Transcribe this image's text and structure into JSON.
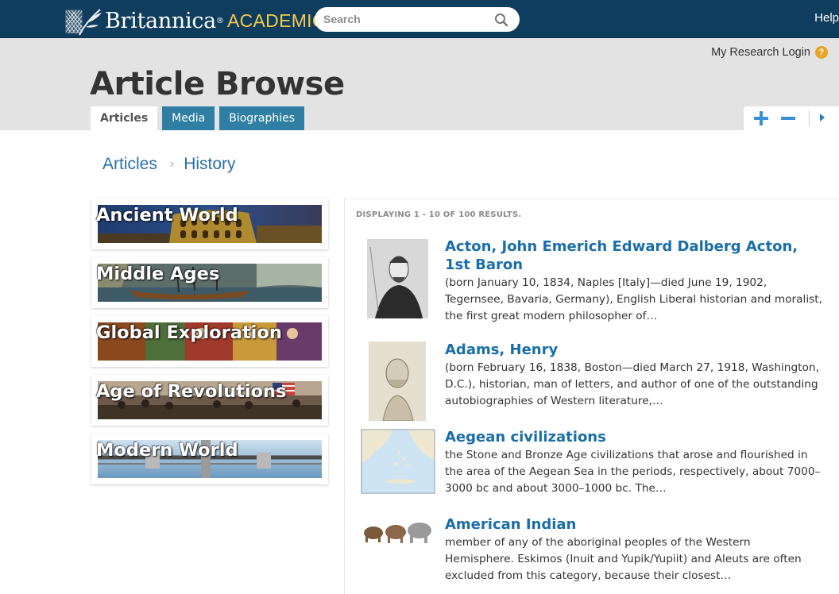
{
  "header": {
    "brand": "Britannica",
    "brand_sub": "ACADEMIC",
    "search_placeholder": "Search",
    "help_label": "Help"
  },
  "band": {
    "login_label": "My Research Login",
    "title": "Article Browse",
    "tabs": [
      {
        "label": "Articles",
        "active": true
      },
      {
        "label": "Media",
        "active": false
      },
      {
        "label": "Biographies",
        "active": false
      }
    ]
  },
  "breadcrumb": {
    "root": "Articles",
    "current": "History"
  },
  "categories": [
    {
      "label": "Ancient World"
    },
    {
      "label": "Middle Ages"
    },
    {
      "label": "Global Exploration"
    },
    {
      "label": "Age of Revolutions"
    },
    {
      "label": "Modern World"
    }
  ],
  "results": {
    "count_text": "DISPLAYING 1 - 10 OF 100 RESULTS.",
    "items": [
      {
        "title": "Acton, John Emerich Edward Dalberg Acton, 1st Baron",
        "desc": "(born January 10, 1834, Naples [Italy]—died June 19, 1902, Tegernsee, Bavaria, Germany), English Liberal historian and moralist, the first great modern philosopher of…"
      },
      {
        "title": "Adams, Henry",
        "desc": "(born February 16, 1838, Boston—died March 27, 1918, Washington, D.C.), historian, man of letters, and author of one of the outstanding autobiographies of Western literature,…"
      },
      {
        "title": "Aegean civilizations",
        "desc": "the Stone and Bronze Age civilizations that arose and flourished in the area of the Aegean Sea in the periods, respectively, about 7000–3000 bc and about 3000–1000 bc. The…"
      },
      {
        "title": "American Indian",
        "desc": "member of any of the aboriginal peoples of the Western Hemisphere. Eskimos (Inuit and Yupik/Yupiit) and Aleuts are often excluded from this category, because their closest…"
      }
    ]
  },
  "colors": {
    "topbar": "#0f3d5e",
    "accent_gold": "#f2c94c",
    "tab_blue": "#2e7fa3",
    "link_blue": "#1a6ea8"
  }
}
